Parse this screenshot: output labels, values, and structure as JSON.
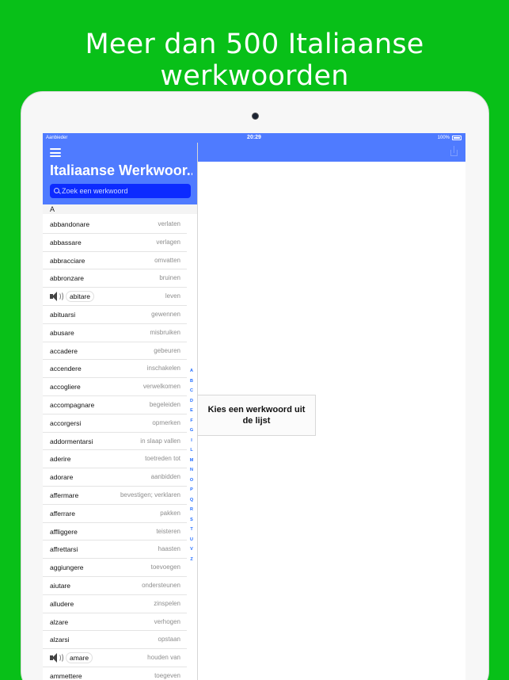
{
  "headline": "Meer dan 500 Italiaanse werkwoorden",
  "status": {
    "carrier": "Aanbieder",
    "time": "20:29",
    "battery": "100%"
  },
  "sidebar": {
    "title": "Italiaanse Werkwoor...",
    "search_placeholder": "Zoek een werkwoord",
    "section": "A",
    "rows": [
      {
        "verb": "abbandonare",
        "trans": "verlaten"
      },
      {
        "verb": "abbassare",
        "trans": "verlagen"
      },
      {
        "verb": "abbracciare",
        "trans": "omvatten"
      },
      {
        "verb": "abbronzare",
        "trans": "bruinen"
      },
      {
        "verb": "abitare",
        "trans": "leven"
      },
      {
        "verb": "abituarsi",
        "trans": "gewennen"
      },
      {
        "verb": "abusare",
        "trans": "misbruiken"
      },
      {
        "verb": "accadere",
        "trans": "gebeuren"
      },
      {
        "verb": "accendere",
        "trans": "inschakelen"
      },
      {
        "verb": "accogliere",
        "trans": "verwelkomen"
      },
      {
        "verb": "accompagnare",
        "trans": "begeleiden"
      },
      {
        "verb": "accorgersi",
        "trans": "opmerken"
      },
      {
        "verb": "addormentarsi",
        "trans": "in slaap vallen"
      },
      {
        "verb": "aderire",
        "trans": "toetreden tot"
      },
      {
        "verb": "adorare",
        "trans": "aanbidden"
      },
      {
        "verb": "affermare",
        "trans": "bevestigen; verklaren"
      },
      {
        "verb": "afferrare",
        "trans": "pakken"
      },
      {
        "verb": "affliggere",
        "trans": "teisteren"
      },
      {
        "verb": "affrettarsi",
        "trans": "haasten"
      },
      {
        "verb": "aggiungere",
        "trans": "toevoegen"
      },
      {
        "verb": "aiutare",
        "trans": "ondersteunen"
      },
      {
        "verb": "alludere",
        "trans": "zinspelen"
      },
      {
        "verb": "alzare",
        "trans": "verhogen"
      },
      {
        "verb": "alzarsi",
        "trans": "opstaan"
      },
      {
        "verb": "amare",
        "trans": "houden van"
      },
      {
        "verb": "ammettere",
        "trans": "toegeven"
      }
    ],
    "index": [
      "A",
      "B",
      "C",
      "D",
      "E",
      "F",
      "G",
      "I",
      "L",
      "M",
      "N",
      "O",
      "P",
      "Q",
      "R",
      "S",
      "T",
      "U",
      "V",
      "Z"
    ]
  },
  "detail": {
    "empty_message": "Kies een werkwoord uit de lijst"
  },
  "colors": {
    "background": "#08c018",
    "accent": "#4f7bff",
    "search": "#0c2bff",
    "index": "#1f6bff"
  }
}
